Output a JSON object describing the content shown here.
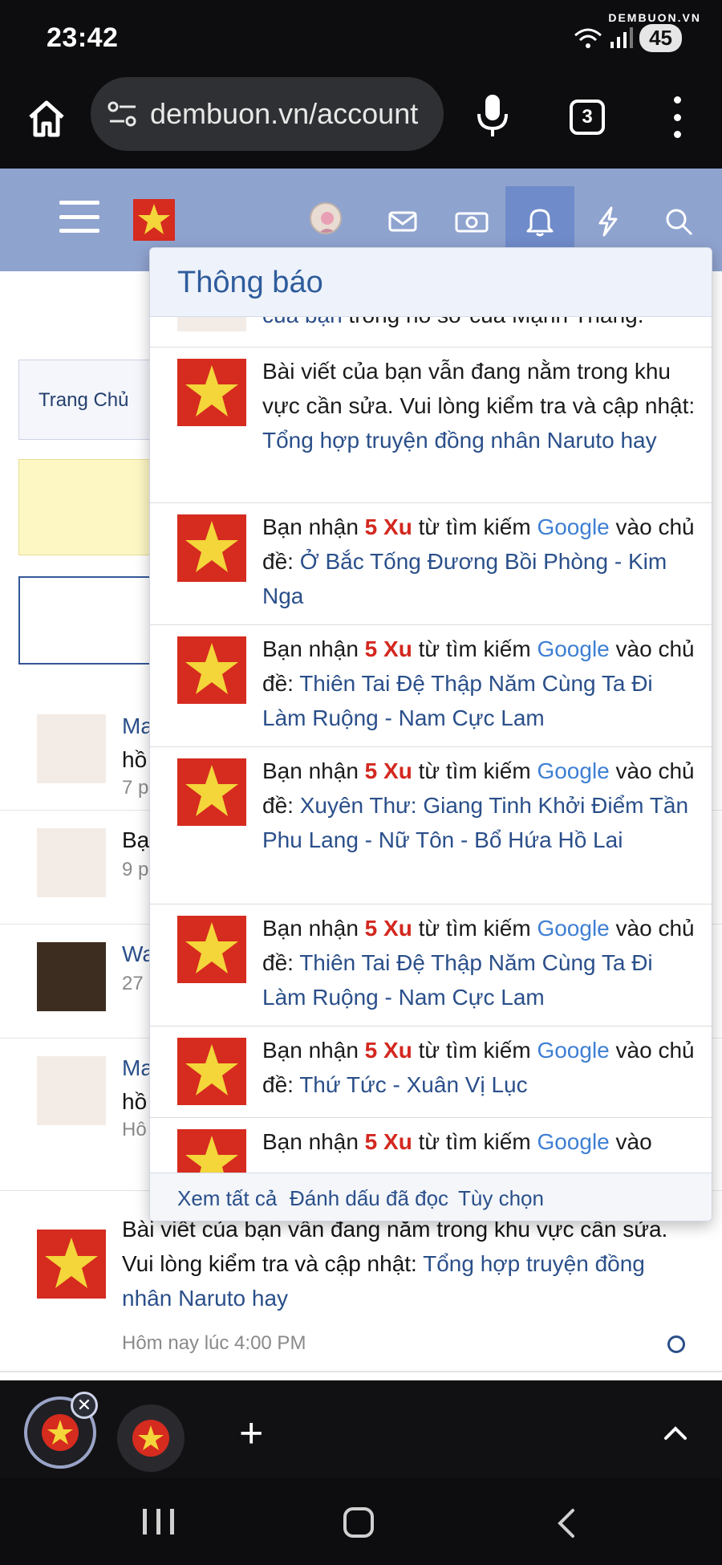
{
  "status_bar": {
    "time": "23:42",
    "watermark": "DEMBUON.VN",
    "battery": "45",
    "icons": [
      "wifi-icon",
      "signal-icon",
      "battery-icon"
    ]
  },
  "browser": {
    "url": "dembuon.vn/account",
    "tab_count": "3",
    "icons": [
      "home-icon",
      "site-settings-icon",
      "microphone-icon",
      "tabs-icon",
      "more-icon"
    ]
  },
  "site_header": {
    "icons": [
      "hamburger-icon",
      "site-logo",
      "avatar",
      "mail-icon",
      "money-icon",
      "bell-icon",
      "lightning-icon",
      "search-icon"
    ]
  },
  "page": {
    "breadcrumb": "Trang Chủ",
    "background_rows": [
      {
        "title": "Ma",
        "line2": "hồ",
        "meta": "7 p"
      },
      {
        "title": "Bạ",
        "meta": "9 p"
      },
      {
        "title": "Wa",
        "meta": "27"
      },
      {
        "title": "Ma",
        "line2": "hồ",
        "meta": "Hô"
      }
    ],
    "last_notification": {
      "text": "Bài viết của bạn vẫn đang nằm trong khu vực cần sửa. Vui lòng kiểm tra và cập nhật: ",
      "link": "Tổng hợp truyện đồng nhân Naruto hay",
      "meta": "Hôm nay lúc 4:00 PM"
    }
  },
  "popup": {
    "title": "Thông báo",
    "partial_top": {
      "link": "của bạn",
      "text": " trong hồ sơ của Mạnh Thắng."
    },
    "notifications": [
      {
        "type": "edit",
        "text": "Bài viết của bạn vẫn đang nằm trong khu vực cần sửa. Vui lòng kiểm tra và cập nhật: ",
        "link": "Tổng hợp truyện đồng nhân Naruto hay"
      },
      {
        "type": "xu",
        "prefix": "Bạn nhận ",
        "xu": "5 Xu",
        "mid": " từ tìm kiếm ",
        "google": "Google",
        "suffix": " vào chủ đề: ",
        "link": "Ở Bắc Tống Đương Bồi Phòng - Kim Nga"
      },
      {
        "type": "xu",
        "prefix": "Bạn nhận ",
        "xu": "5 Xu",
        "mid": " từ tìm kiếm ",
        "google": "Google",
        "suffix": " vào chủ đề: ",
        "link": "Thiên Tai Đệ Thập Năm Cùng Ta Đi Làm Ruộng - Nam Cực Lam"
      },
      {
        "type": "xu",
        "prefix": "Bạn nhận ",
        "xu": "5 Xu",
        "mid": " từ tìm kiếm ",
        "google": "Google",
        "suffix": " vào chủ đề: ",
        "link": "Xuyên Thư: Giang Tinh Khởi Điểm Tần Phu Lang - Nữ Tôn - Bổ Hứa Hồ Lai"
      },
      {
        "type": "xu",
        "prefix": "Bạn nhận ",
        "xu": "5 Xu",
        "mid": " từ tìm kiếm ",
        "google": "Google",
        "suffix": " vào chủ đề: ",
        "link": "Thiên Tai Đệ Thập Năm Cùng Ta Đi Làm Ruộng - Nam Cực Lam"
      },
      {
        "type": "xu",
        "prefix": "Bạn nhận ",
        "xu": "5 Xu",
        "mid": " từ tìm kiếm ",
        "google": "Google",
        "suffix": " vào chủ đề: ",
        "link": "Thứ Tức - Xuân Vị Lục"
      },
      {
        "type": "xu",
        "prefix": "Bạn nhận ",
        "xu": "5 Xu",
        "mid": " từ tìm kiếm ",
        "google": "Google",
        "suffix": " vào"
      }
    ],
    "footer": {
      "view_all": "Xem tất cả",
      "mark_read": "Đánh dấu đã đọc",
      "options": "Tùy chọn"
    }
  },
  "tab_strip": {
    "icons": [
      "tab-thumbnail",
      "close-tab-icon",
      "new-tab-icon",
      "chevron-up-icon"
    ]
  },
  "nav_bar": {
    "icons": [
      "recent-apps-icon",
      "home-nav-icon",
      "back-icon"
    ]
  },
  "colors": {
    "header_blue": "#8fa3cf",
    "link": "#2a4f8a",
    "xu_red": "#d3281f",
    "google_blue": "#3e7fd3",
    "logo_red": "#d62b1f"
  }
}
